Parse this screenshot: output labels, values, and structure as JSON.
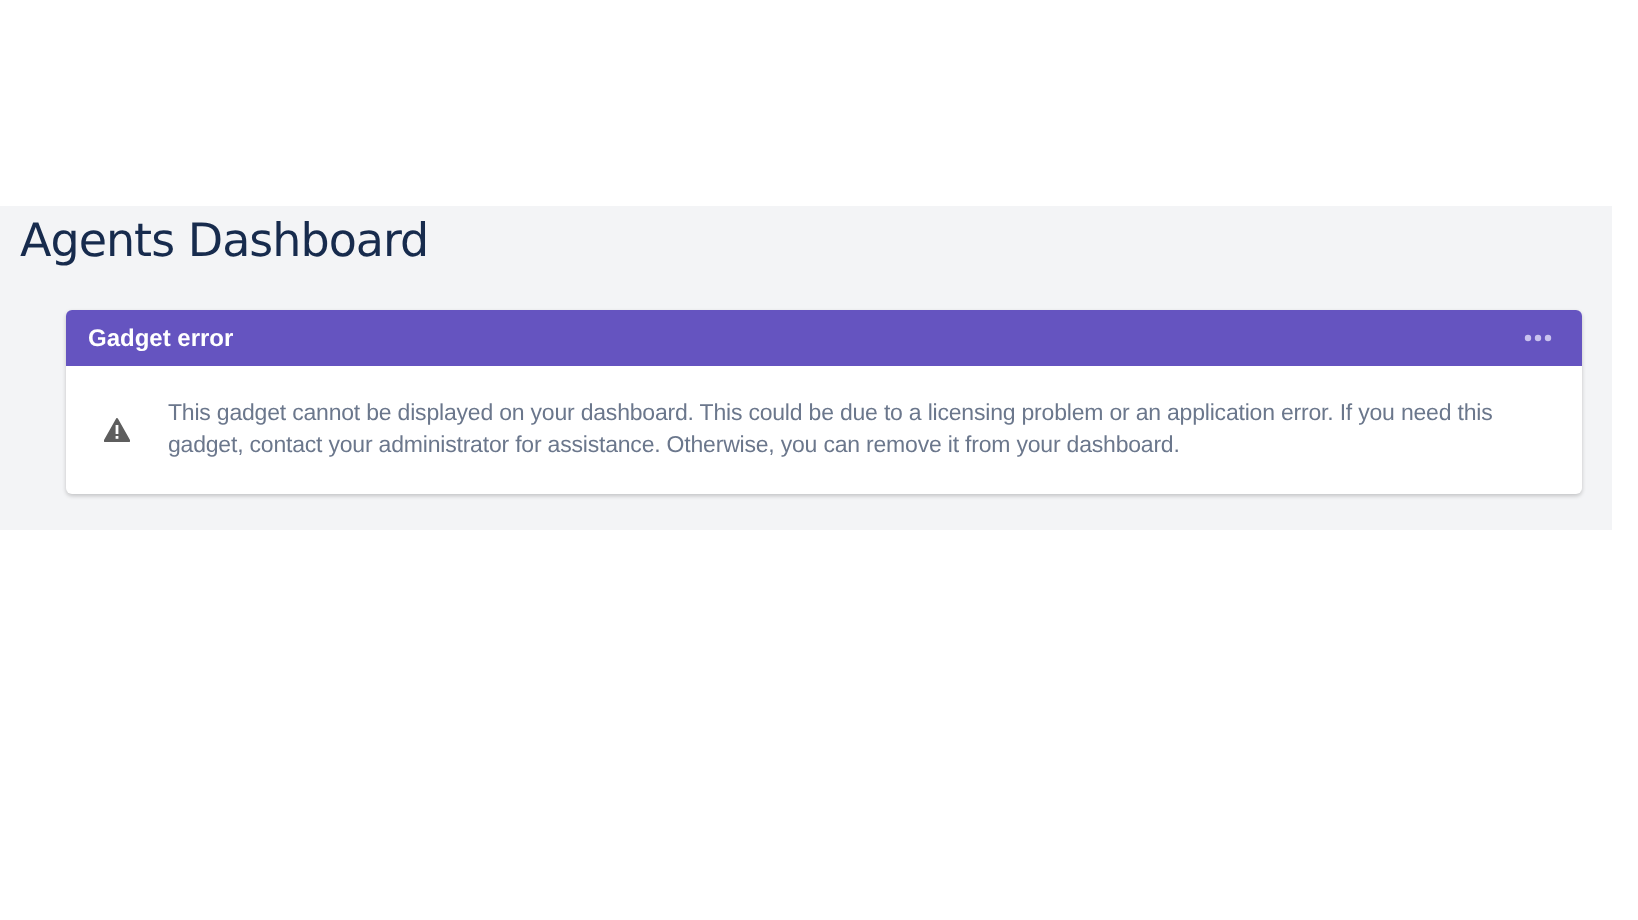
{
  "page": {
    "title": "Agents Dashboard"
  },
  "gadget": {
    "title": "Gadget error",
    "message": "This gadget cannot be displayed on your dashboard. This could be due to a licensing problem or an application error. If you need this gadget, contact your administrator for assistance. Otherwise, you can remove it from your dashboard."
  }
}
